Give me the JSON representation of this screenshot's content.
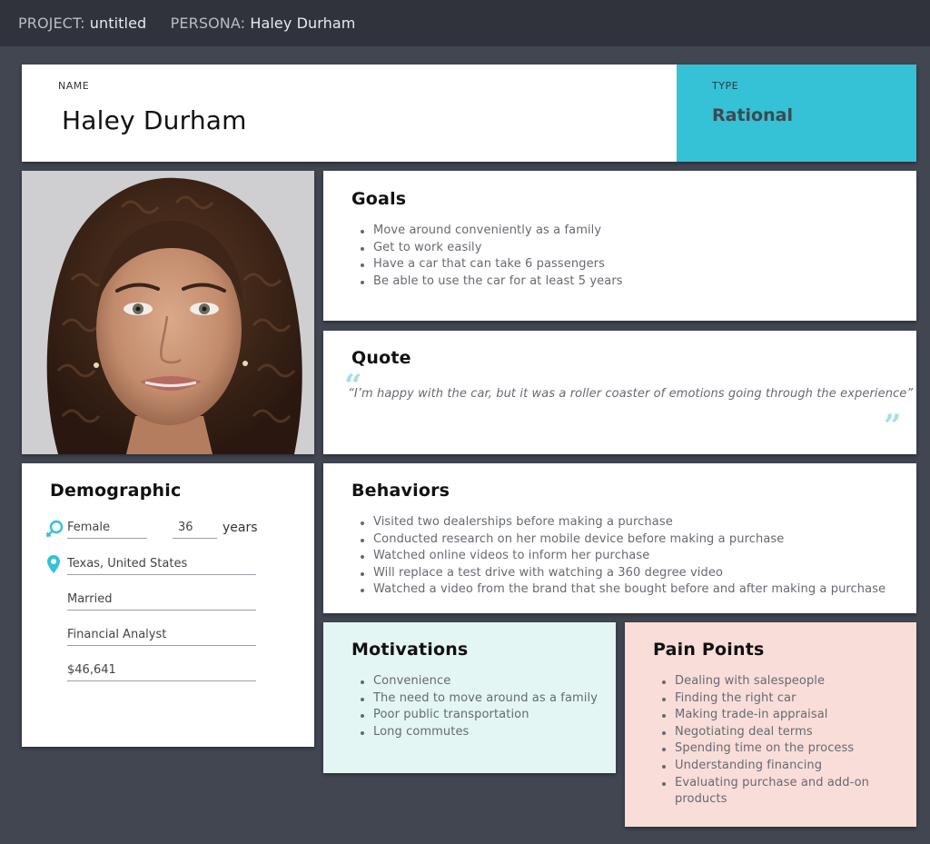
{
  "header": {
    "project_label": "PROJECT:",
    "project_value": "untitled",
    "persona_label": "PERSONA:",
    "persona_value": "Haley Durham"
  },
  "name_card": {
    "label": "NAME",
    "value": "Haley Durham",
    "type_label": "TYPE",
    "type_value": "Rational",
    "type_color": "#35c1d6"
  },
  "goals": {
    "title": "Goals",
    "items": [
      "Move around conveniently as a family",
      "Get to work easily",
      "Have a car that can take 6 passengers",
      "Be able to use the car for at least 5 years"
    ]
  },
  "quote": {
    "title": "Quote",
    "text": "“I’m happy with the car, but it was a roller coaster of emotions going through the experience”",
    "open_mark": "“",
    "close_mark": "”"
  },
  "demographic": {
    "title": "Demographic",
    "gender": "Female",
    "age": "36",
    "age_unit": "years",
    "location": "Texas, United States",
    "marital_status": "Married",
    "occupation": "Financial Analyst",
    "income": "$46,641",
    "icons": [
      "female-gender-icon",
      "location-pin-icon"
    ],
    "icon_color": "#35c1d6"
  },
  "behaviors": {
    "title": "Behaviors",
    "items": [
      "Visited two dealerships before making a purchase",
      "Conducted research on her mobile device before making a purchase",
      "Watched online videos to inform her purchase",
      "Will replace a test drive with watching a 360 degree video",
      "Watched a video from the brand that she bought before and after making a purchase"
    ]
  },
  "motivations": {
    "title": "Motivations",
    "background": "#e3f6f3",
    "items": [
      "Convenience",
      "The need to move around as a family",
      "Poor public transportation",
      "Long commutes"
    ]
  },
  "pain_points": {
    "title": "Pain Points",
    "background": "#f9ddd9",
    "items": [
      "Dealing with salespeople",
      "Finding the right car",
      "Making trade-in appraisal",
      "Negotiating deal terms",
      "Spending time on the process",
      "Understanding financing",
      "Evaluating purchase and add-on products"
    ]
  }
}
